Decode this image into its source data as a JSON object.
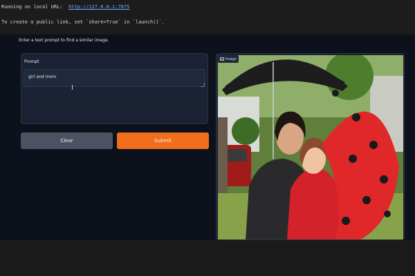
{
  "terminal": {
    "line1_prefix": "Running on local URL:  ",
    "line1_url": "http://127.0.0.1:7875",
    "line2": "To create a public link, set `share=True` in `launch()`."
  },
  "app": {
    "description": "Enter a text prompt to find a similar image.",
    "prompt": {
      "label": "Prompt",
      "value": "girl and mom"
    },
    "buttons": {
      "clear": "Clear",
      "submit": "Submit"
    },
    "image_output": {
      "label": "Image",
      "icon": "image-icon"
    }
  },
  "colors": {
    "app_bg": "#0c111c",
    "submit": "#f06e1c",
    "clear": "#4b5262",
    "link": "#6fa8ff"
  }
}
